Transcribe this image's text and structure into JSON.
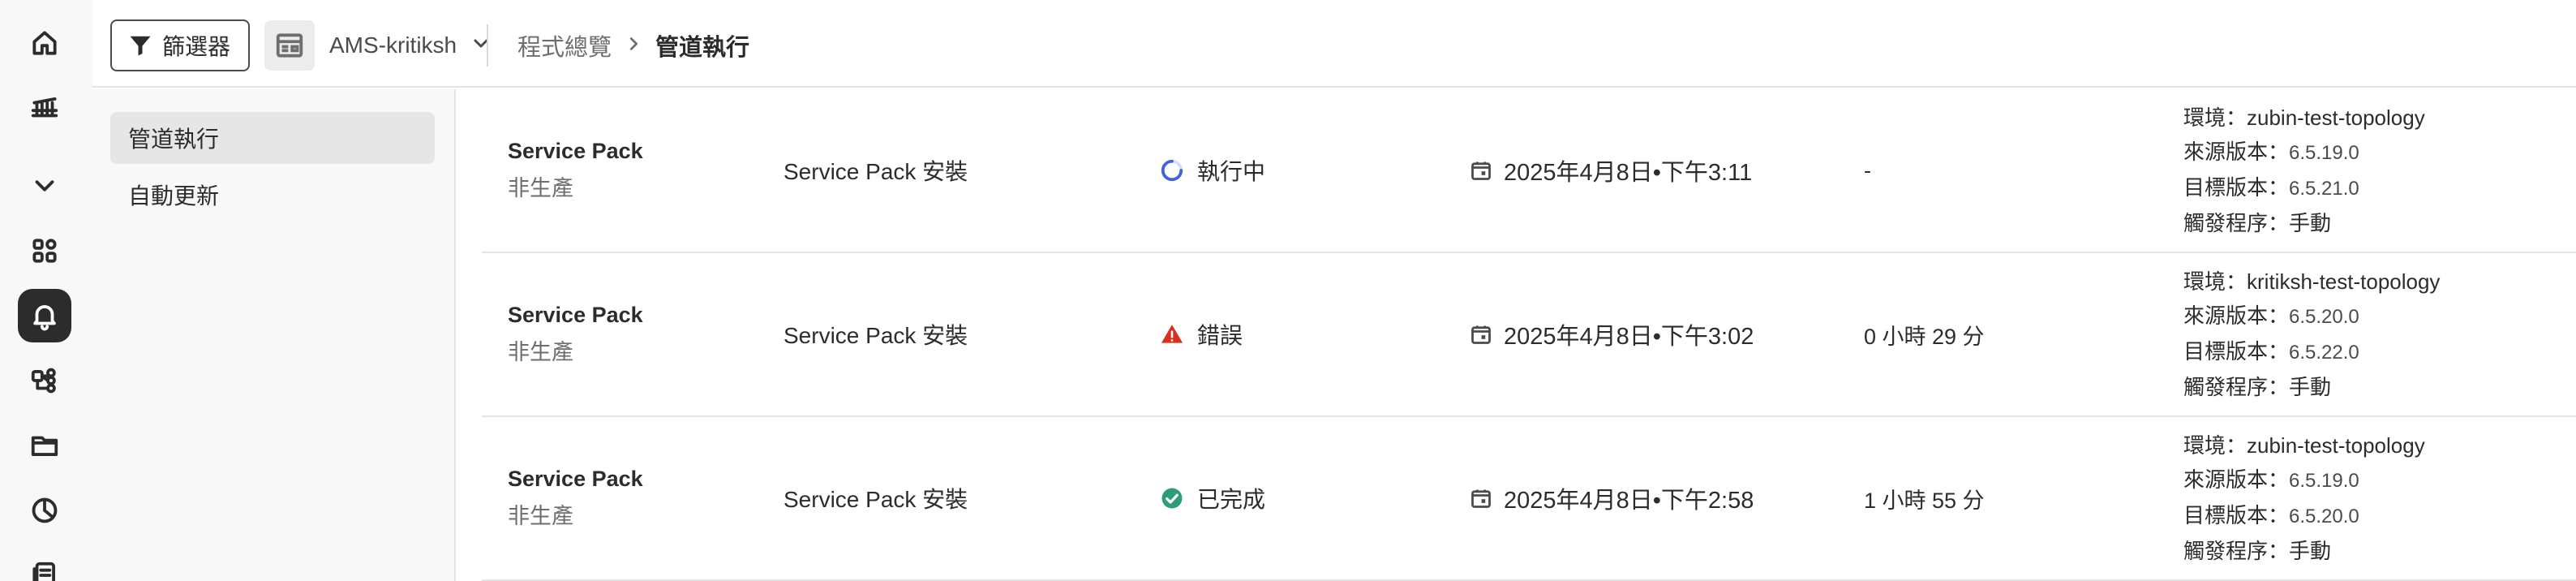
{
  "rail": {
    "icons": [
      "home-icon",
      "releases-icon",
      "chevron-down-icon",
      "apps-icon",
      "bell-icon",
      "workflow-icon",
      "folder-icon",
      "dashboard-icon",
      "documents-icon"
    ]
  },
  "header": {
    "filter_label": "篩選器",
    "org_name": "AMS-kritiksh",
    "breadcrumb_parent": "程式總覽",
    "breadcrumb_current": "管道執行"
  },
  "nav": {
    "items": [
      {
        "label": "管道執行",
        "selected": true
      },
      {
        "label": "自動更新",
        "selected": false
      }
    ]
  },
  "rows": [
    {
      "title": "Service Pack",
      "subtitle": "非生產",
      "name": "Service Pack 安裝",
      "status": "執行中",
      "status_icon": "spinner-icon",
      "date": "2025年4月8日•下午3:11",
      "duration": "-",
      "env_label": "環境：",
      "env_value": "zubin-test-topology",
      "src_label": "來源版本：",
      "src_value": "6.5.19.0",
      "tgt_label": "目標版本：",
      "tgt_value": "6.5.21.0",
      "trigger_label": "觸發程序：",
      "trigger_value": "手動"
    },
    {
      "title": "Service Pack",
      "subtitle": "非生產",
      "name": "Service Pack 安裝",
      "status": "錯誤",
      "status_icon": "alert-icon",
      "date": "2025年4月8日•下午3:02",
      "duration": "0 小時 29 分",
      "env_label": "環境：",
      "env_value": "kritiksh-test-topology",
      "src_label": "來源版本：",
      "src_value": "6.5.20.0",
      "tgt_label": "目標版本：",
      "tgt_value": "6.5.22.0",
      "trigger_label": "觸發程序：",
      "trigger_value": "手動"
    },
    {
      "title": "Service Pack",
      "subtitle": "非生產",
      "name": "Service Pack 安裝",
      "status": "已完成",
      "status_icon": "checkmark-circle-icon",
      "date": "2025年4月8日•下午2:58",
      "duration": "1 小時 55 分",
      "env_label": "環境：",
      "env_value": "zubin-test-topology",
      "src_label": "來源版本：",
      "src_value": "6.5.19.0",
      "tgt_label": "目標版本：",
      "tgt_value": "6.5.20.0",
      "trigger_label": "觸發程序：",
      "trigger_value": "手動"
    }
  ],
  "colors": {
    "running": "#3e63dd",
    "error": "#d73220",
    "success": "#2d9d78"
  }
}
